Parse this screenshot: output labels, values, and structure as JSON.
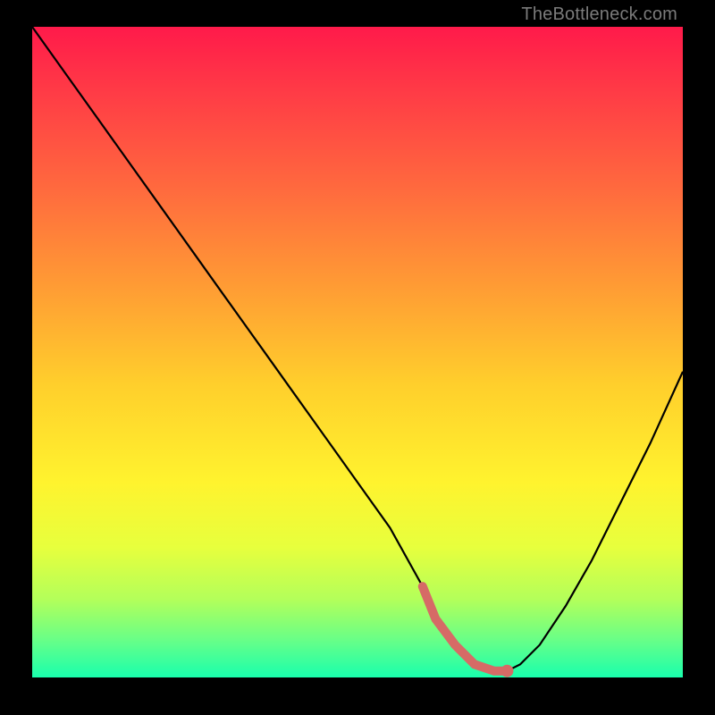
{
  "watermark": "TheBottleneck.com",
  "chart_data": {
    "type": "line",
    "title": "",
    "xlabel": "",
    "ylabel": "",
    "xlim": [
      0,
      100
    ],
    "ylim": [
      0,
      100
    ],
    "series": [
      {
        "name": "bottleneck-curve",
        "x": [
          0,
          5,
          10,
          15,
          20,
          25,
          30,
          35,
          40,
          45,
          50,
          55,
          60,
          62,
          65,
          68,
          71,
          73,
          75,
          78,
          82,
          86,
          90,
          95,
          100
        ],
        "y": [
          100,
          93,
          86,
          79,
          72,
          65,
          58,
          51,
          44,
          37,
          30,
          23,
          14,
          9,
          5,
          2,
          1,
          1,
          2,
          5,
          11,
          18,
          26,
          36,
          47
        ]
      }
    ],
    "markers": [
      {
        "name": "highlight-segment",
        "x_range": [
          60,
          73
        ],
        "color": "#d66b66"
      },
      {
        "name": "highlight-dot",
        "x": 73,
        "y": 1,
        "color": "#d66b66"
      }
    ],
    "gradient_stops": [
      {
        "pos": 0.0,
        "color": "#ff1a4a"
      },
      {
        "pos": 0.55,
        "color": "#ffcf2c"
      },
      {
        "pos": 1.0,
        "color": "#19ffad"
      }
    ]
  }
}
